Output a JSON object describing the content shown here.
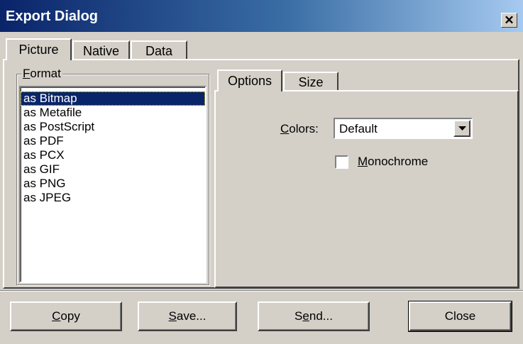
{
  "window": {
    "title": "Export Dialog",
    "close_glyph": "✕"
  },
  "tabs": [
    {
      "label": "Picture",
      "active": true
    },
    {
      "label": "Native",
      "active": false
    },
    {
      "label": "Data",
      "active": false
    }
  ],
  "format_group": {
    "label_mnemonic": "F",
    "label_rest": "ormat",
    "items": [
      "as Bitmap",
      "as Metafile",
      "as PostScript",
      "as PDF",
      "as PCX",
      "as GIF",
      "as PNG",
      "as JPEG"
    ],
    "selected": "as Bitmap"
  },
  "subtabs": [
    {
      "label": "Options",
      "active": true
    },
    {
      "label": "Size",
      "active": false
    }
  ],
  "options": {
    "colors_label_mnemonic": "C",
    "colors_label_rest": "olors:",
    "colors_value": "Default",
    "monochrome_mnemonic": "M",
    "monochrome_rest": "onochrome",
    "monochrome_checked": false
  },
  "buttons": {
    "copy": {
      "mnemonic": "C",
      "rest": "opy"
    },
    "save": {
      "mnemonic": "S",
      "rest": "ave..."
    },
    "send": {
      "pre": "S",
      "mnemonic": "e",
      "rest": "nd..."
    },
    "close": {
      "label": "Close"
    }
  },
  "icons": {
    "close": "close-icon",
    "dropdown": "dropdown-arrow-icon"
  },
  "colors": {
    "title_bar_start": "#0a246a",
    "title_bar_end": "#a6caf0",
    "face": "#d4d0c8",
    "selection": "#0a246a"
  }
}
